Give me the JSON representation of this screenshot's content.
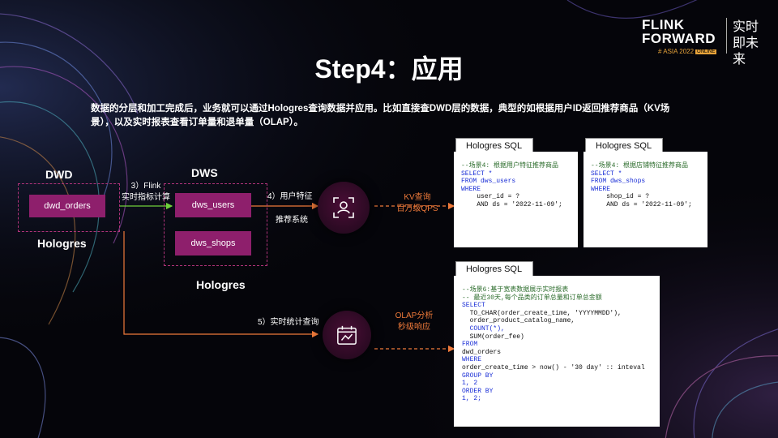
{
  "slide": {
    "title": "Step4：应用",
    "intro": "数据的分层和加工完成后，业务就可以通过Hologres查询数据并应用。比如直接查DWD层的数据，典型的如根据用户ID返回推荐商品（KV场景），以及实时报表查看订单量和退单量（OLAP）。"
  },
  "brand": {
    "line1": "FLINK",
    "line2": "FORWARD",
    "event": "# ASIA 2022",
    "badge": "ONLINE",
    "cn_tagline": "实时即未来"
  },
  "diagram": {
    "dwd": {
      "title": "DWD",
      "table": "dwd_orders",
      "engine": "Hologres"
    },
    "dws": {
      "title": "DWS",
      "tables": [
        "dws_users",
        "dws_shops"
      ],
      "engine": "Hologres"
    },
    "edges": {
      "flink_line1": "3）Flink",
      "flink_line2": "实时指标计算",
      "user_feature": "4）用户特征",
      "recommend_system": "推荐系统",
      "realtime_query": "5）实时统计查询"
    },
    "outcomes": {
      "kv_line1": "KV查询",
      "kv_line2": "百万级QPS",
      "olap_line1": "OLAP分析",
      "olap_line2": "秒级响应"
    },
    "colors": {
      "box": "#8e1f6c",
      "dash": "#b0337a",
      "arrow_orange": "#ef7a3a",
      "arrow_green": "#6fcf3a"
    }
  },
  "sql_cards": [
    {
      "tab": "Hologres SQL",
      "lines": [
        "--场景4: 根据用户特征推荐商品",
        "SELECT *",
        "FROM dws_users",
        "WHERE",
        "    user_id = ?",
        "    AND ds = '2022-11-09';"
      ]
    },
    {
      "tab": "Hologres SQL",
      "lines": [
        "--场景4: 根据店铺特征推荐商品",
        "SELECT *",
        "FROM dws_shops",
        "WHERE",
        "    shop_id = ?",
        "    AND ds = '2022-11-09';"
      ]
    },
    {
      "tab": "Hologres SQL",
      "lines": [
        "--场景6:基于宽表数据展示实时报表",
        "-- 最近30天,每个品类的订单总量和订单总金额",
        "SELECT",
        "  TO_CHAR(order_create_time, 'YYYYMMDD'),",
        "  order_product_catalog_name,",
        "  COUNT(*),",
        "  SUM(order_fee)",
        "FROM",
        "dwd_orders",
        "WHERE",
        "order_create_time > now() - '30 day' :: inteval",
        "GROUP BY",
        "1, 2",
        "ORDER BY",
        "1, 2;"
      ]
    }
  ]
}
